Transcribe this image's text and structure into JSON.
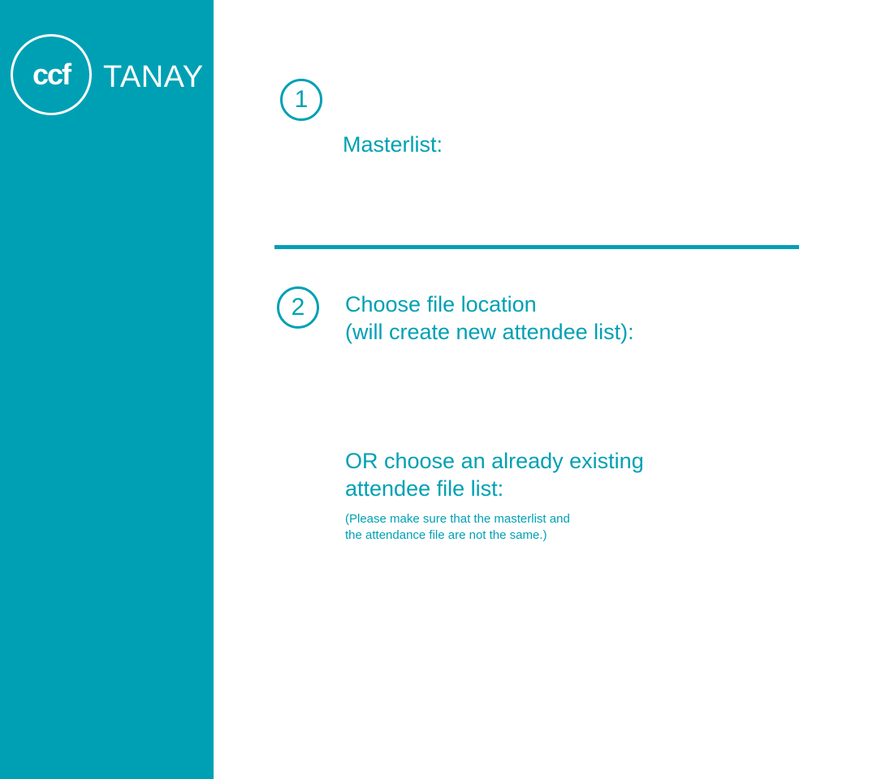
{
  "sidebar": {
    "logo": {
      "mark": "ccf",
      "text": "TANAY"
    }
  },
  "step1": {
    "number": "1",
    "label": "Masterlist:"
  },
  "step2": {
    "number": "2",
    "choose_location_line1": "Choose file location",
    "choose_location_line2": "(will create new attendee list):",
    "or_existing_line1": "OR choose an already existing",
    "or_existing_line2": "attendee file list:",
    "note_line1": "(Please make sure that the masterlist and",
    "note_line2": "the attendance file are not the same.)"
  },
  "colors": {
    "accent": "#00a0b4",
    "background": "#ffffff",
    "logo": "#ffffff"
  }
}
